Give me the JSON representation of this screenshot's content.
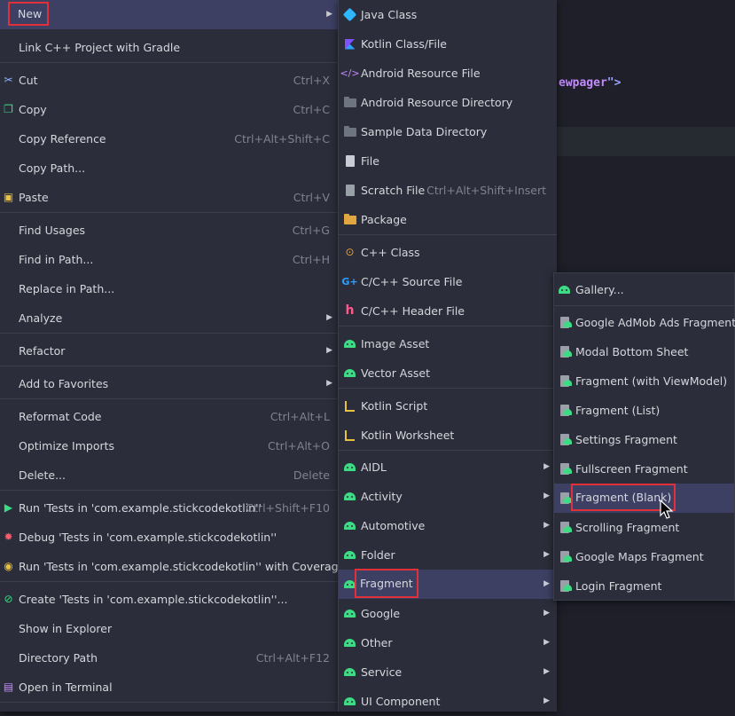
{
  "editor": {
    "code_attr": "ewpager",
    "code_tag": "\">"
  },
  "main_menu": {
    "new": "New",
    "link_cpp": "Link C++ Project with Gradle",
    "cut": "Cut",
    "cut_sc": "Ctrl+X",
    "copy": "Copy",
    "copy_sc": "Ctrl+C",
    "copy_ref": "Copy Reference",
    "copy_ref_sc": "Ctrl+Alt+Shift+C",
    "copy_path": "Copy Path...",
    "paste": "Paste",
    "paste_sc": "Ctrl+V",
    "find_usages": "Find Usages",
    "find_usages_sc": "Ctrl+G",
    "find_in_path": "Find in Path...",
    "find_in_path_sc": "Ctrl+H",
    "replace_in_path": "Replace in Path...",
    "analyze": "Analyze",
    "refactor": "Refactor",
    "add_fav": "Add to Favorites",
    "reformat": "Reformat Code",
    "reformat_sc": "Ctrl+Alt+L",
    "optimize": "Optimize Imports",
    "optimize_sc": "Ctrl+Alt+O",
    "delete": "Delete...",
    "delete_sc": "Delete",
    "run_tests": "Run 'Tests in 'com.example.stickcodekotlin''",
    "run_tests_sc": "Ctrl+Shift+F10",
    "debug_tests": "Debug 'Tests in 'com.example.stickcodekotlin''",
    "run_cov": "Run 'Tests in 'com.example.stickcodekotlin'' with Coverage",
    "create_tests": "Create 'Tests in 'com.example.stickcodekotlin''...",
    "show_explorer": "Show in Explorer",
    "dir_path": "Directory Path",
    "dir_path_sc": "Ctrl+Alt+F12",
    "open_terminal": "Open in Terminal"
  },
  "new_menu": {
    "java_class": "Java Class",
    "kotlin_class": "Kotlin Class/File",
    "android_res_file": "Android Resource File",
    "android_res_dir": "Android Resource Directory",
    "sample_data": "Sample Data Directory",
    "file": "File",
    "scratch": "Scratch File",
    "scratch_sc": "Ctrl+Alt+Shift+Insert",
    "package": "Package",
    "cpp_class": "C++ Class",
    "cpp_source": "C/C++ Source File",
    "cpp_header": "C/C++ Header File",
    "image_asset": "Image Asset",
    "vector_asset": "Vector Asset",
    "kotlin_script": "Kotlin Script",
    "kotlin_worksheet": "Kotlin Worksheet",
    "aidl": "AIDL",
    "activity": "Activity",
    "automotive": "Automotive",
    "folder": "Folder",
    "fragment": "Fragment",
    "google": "Google",
    "other": "Other",
    "service": "Service",
    "ui_component": "UI Component"
  },
  "fragment_menu": {
    "gallery": "Gallery...",
    "admob": "Google AdMob Ads Fragment",
    "modal_bottom": "Modal Bottom Sheet",
    "with_vm": "Fragment (with ViewModel)",
    "list": "Fragment (List)",
    "settings": "Settings Fragment",
    "fullscreen": "Fullscreen Fragment",
    "blank": "Fragment (Blank)",
    "scrolling": "Scrolling Fragment",
    "maps": "Google Maps Fragment",
    "login": "Login Fragment"
  },
  "colors": {
    "menu_bg": "#2b2d3a",
    "highlight": "#3d4063",
    "red_box": "#e0303a",
    "android_green": "#3ddc84"
  }
}
